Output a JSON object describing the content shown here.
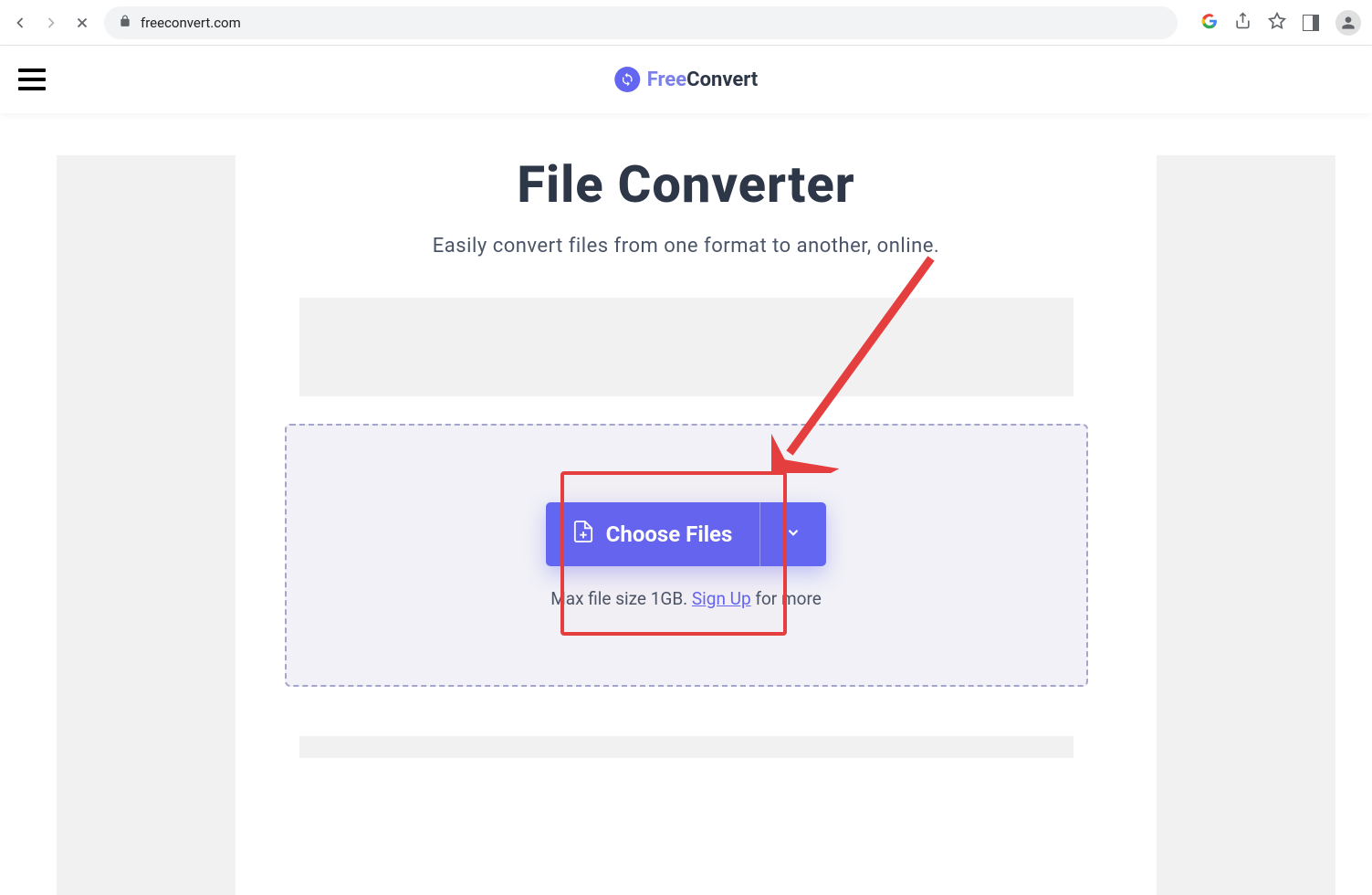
{
  "browser": {
    "url": "freeconvert.com"
  },
  "header": {
    "brand_free": "Free",
    "brand_convert": "Convert"
  },
  "main": {
    "title": "File Converter",
    "subtitle": "Easily convert files from one format to another, online.",
    "choose_files_label": "Choose Files",
    "max_file_prefix": "Max file size 1GB. ",
    "sign_up_label": "Sign Up",
    "max_file_suffix": " for more"
  }
}
